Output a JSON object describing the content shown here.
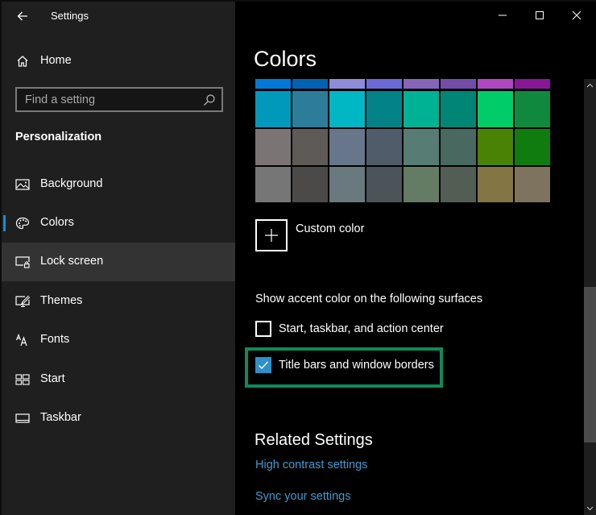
{
  "window": {
    "title": "Settings",
    "controls": {
      "minimize": "minimize-icon",
      "maximize": "maximize-icon",
      "close": "close-icon"
    }
  },
  "sidebar": {
    "back_icon": "arrow-left-icon",
    "home_label": "Home",
    "home_icon": "home-icon",
    "search": {
      "placeholder": "Find a setting",
      "value": "",
      "icon": "search-icon"
    },
    "section_title": "Personalization",
    "items": [
      {
        "label": "Background",
        "icon": "image-icon",
        "selected": false,
        "hover": false
      },
      {
        "label": "Colors",
        "icon": "palette-icon",
        "selected": true,
        "hover": false
      },
      {
        "label": "Lock screen",
        "icon": "lock-screen-icon",
        "selected": false,
        "hover": true
      },
      {
        "label": "Themes",
        "icon": "themes-icon",
        "selected": false,
        "hover": false
      },
      {
        "label": "Fonts",
        "icon": "fonts-icon",
        "selected": false,
        "hover": false
      },
      {
        "label": "Start",
        "icon": "start-icon",
        "selected": false,
        "hover": false
      },
      {
        "label": "Taskbar",
        "icon": "taskbar-icon",
        "selected": false,
        "hover": false
      }
    ],
    "accent_indicator_color": "#1a8ad4"
  },
  "main": {
    "title": "Colors",
    "swatch_rows": [
      [
        "#0078d7",
        "#0063b1",
        "#8e8cd8",
        "#6b69d6",
        "#8764b8",
        "#744da9",
        "#b146c2",
        "#881798"
      ],
      [
        "#0099bc",
        "#2d7d9a",
        "#00b7c3",
        "#038387",
        "#00b294",
        "#018574",
        "#00cc6a",
        "#10893e"
      ],
      [
        "#7a7574",
        "#5d5a58",
        "#68768a",
        "#515c6b",
        "#567c73",
        "#486860",
        "#498205",
        "#107c10"
      ],
      [
        "#767676",
        "#4c4a48",
        "#69797e",
        "#4a5459",
        "#647c64",
        "#525e54",
        "#847545",
        "#7e735f"
      ]
    ],
    "custom_color_label": "Custom color",
    "custom_color_icon": "plus-icon",
    "surfaces_label": "Show accent color on the following surfaces",
    "checkboxes": [
      {
        "label": "Start, taskbar, and action center",
        "checked": false
      },
      {
        "label": "Title bars and window borders",
        "checked": true
      }
    ],
    "highlight_color": "#0f8a5a",
    "related_title": "Related Settings",
    "links": [
      "High contrast settings",
      "Sync your settings"
    ],
    "link_color": "#3b9bd1"
  },
  "scrollbar": {
    "up_icon": "chevron-up-icon",
    "down_icon": "chevron-down-icon",
    "position_fraction": 0.55
  }
}
